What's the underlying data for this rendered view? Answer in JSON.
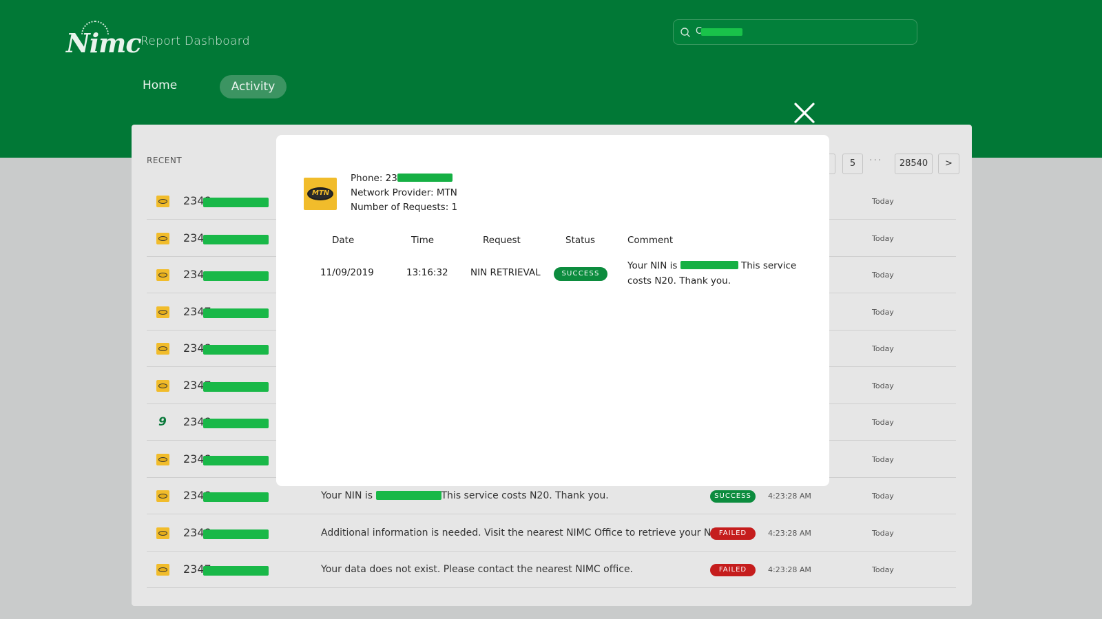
{
  "header": {
    "logo_text": "Nimc",
    "title": "Report Dashboard",
    "search": {
      "value": "C"
    },
    "nav": {
      "home": "Home",
      "activity": "Activity"
    }
  },
  "colors": {
    "brand_green": "#017836",
    "success": "#0c8c3e",
    "failed": "#c51d1d"
  },
  "panel": {
    "recent_label": "RECENT",
    "pager": {
      "page_5": "5",
      "dots": "···",
      "last_page": "28540",
      "next": ">"
    },
    "rows": [
      {
        "provider_icon": "mtn-icon",
        "phone_prefix": "2348",
        "comment": "",
        "status": "",
        "time": "",
        "day": "Today"
      },
      {
        "provider_icon": "mtn-icon",
        "phone_prefix": "234",
        "comment": "",
        "status": "",
        "time": "",
        "day": "Today"
      },
      {
        "provider_icon": "mtn-icon",
        "phone_prefix": "234",
        "comment": "",
        "status": "",
        "time": "",
        "day": "Today"
      },
      {
        "provider_icon": "mtn-icon",
        "phone_prefix": "2347",
        "comment": "",
        "status": "",
        "time": "",
        "day": "Today"
      },
      {
        "provider_icon": "mtn-icon",
        "phone_prefix": "2348",
        "comment": "",
        "status": "",
        "time": "",
        "day": "Today"
      },
      {
        "provider_icon": "mtn-icon",
        "phone_prefix": "2347",
        "comment": "",
        "status": "",
        "time": "",
        "day": "Today"
      },
      {
        "provider_icon": "9mobile-icon",
        "phone_prefix": "2348",
        "comment": "",
        "status": "",
        "time": "",
        "day": "Today"
      },
      {
        "provider_icon": "mtn-icon",
        "phone_prefix": "2348",
        "comment": "",
        "status": "",
        "time": "",
        "day": "Today"
      },
      {
        "provider_icon": "mtn-icon",
        "phone_prefix": "2348",
        "comment_before": "Your NIN is ",
        "comment_after": "This service costs N20. Thank you.",
        "status": "SUCCESS",
        "time": "4:23:28 AM",
        "day": "Today"
      },
      {
        "provider_icon": "mtn-icon",
        "phone_prefix": "2348",
        "comment": "Additional information is needed. Visit the nearest NIMC Office to retrieve your NIN.",
        "status": "FAILED",
        "time": "4:23:28 AM",
        "day": "Today"
      },
      {
        "provider_icon": "mtn-icon",
        "phone_prefix": "2347",
        "comment": "Your data does not exist. Please contact the nearest NIMC office.",
        "status": "FAILED",
        "time": "4:23:28 AM",
        "day": "Today"
      }
    ]
  },
  "modal": {
    "logo_text": "MTN",
    "phone_label": "Phone: 23",
    "provider_line": "Network Provider: MTN",
    "requests_line": "Number of Requests: 1",
    "headers": {
      "date": "Date",
      "time": "Time",
      "request": "Request",
      "status": "Status",
      "comment": "Comment"
    },
    "record": {
      "date": "11/09/2019",
      "time": "13:16:32",
      "request": "NIN RETRIEVAL",
      "status": "SUCCESS",
      "comment_before": "Your NIN is ",
      "comment_after": " This service costs N20. Thank you."
    }
  }
}
